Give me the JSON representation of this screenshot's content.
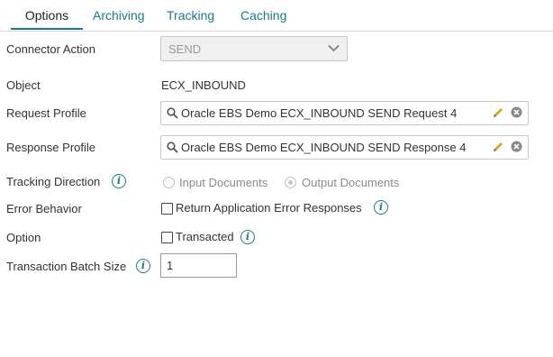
{
  "tabs": [
    "Options",
    "Archiving",
    "Tracking",
    "Caching"
  ],
  "active_tab": "Options",
  "colors": {
    "accent": "#1a7a8a",
    "pencil": "#e0a020"
  },
  "form": {
    "connector_action": {
      "label": "Connector Action",
      "value": "SEND"
    },
    "object": {
      "label": "Object",
      "value": "ECX_INBOUND"
    },
    "request_profile": {
      "label": "Request Profile",
      "value": "Oracle EBS Demo ECX_INBOUND SEND Request 4"
    },
    "response_profile": {
      "label": "Response Profile",
      "value": "Oracle EBS Demo ECX_INBOUND SEND Response 4"
    },
    "tracking_direction": {
      "label": "Tracking Direction",
      "options": [
        "Input Documents",
        "Output Documents"
      ],
      "selected": "Output Documents"
    },
    "error_behavior": {
      "label": "Error Behavior",
      "checkbox_label": "Return Application Error Responses",
      "checked": false
    },
    "option": {
      "label": "Option",
      "checkbox_label": "Transacted",
      "checked": false
    },
    "transaction_batch_size": {
      "label": "Transaction Batch Size",
      "value": "1"
    }
  }
}
